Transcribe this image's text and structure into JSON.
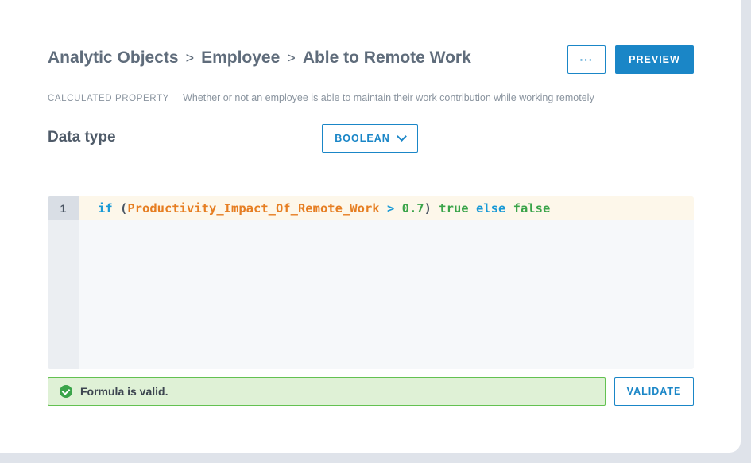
{
  "breadcrumb": {
    "items": [
      "Analytic Objects",
      "Employee",
      "Able to Remote Work"
    ],
    "separator": ">"
  },
  "actions": {
    "more_label": "···",
    "preview_label": "PREVIEW"
  },
  "subtitle": {
    "kind": "CALCULATED PROPERTY",
    "separator": "|",
    "description": "Whether or not an employee is able to maintain their work contribution while working remotely"
  },
  "data_type": {
    "label": "Data type",
    "selected": "BOOLEAN"
  },
  "editor": {
    "line_number": "1",
    "tokens": {
      "kw_if": "if",
      "open_paren": " (",
      "identifier": "Productivity_Impact_Of_Remote_Work",
      "operator": " > ",
      "number": "0.7",
      "close_paren": ")",
      "true_kw": " true",
      "else_kw": " else",
      "false_kw": " false"
    }
  },
  "validation": {
    "message": "Formula is valid.",
    "button_label": "VALIDATE"
  },
  "colors": {
    "accent": "#1a86c7",
    "success_bg": "#dff1d6",
    "success_border": "#63c151",
    "identifier": "#e67e22",
    "keyword": "#1a9ad6",
    "literal": "#3aa44a"
  }
}
